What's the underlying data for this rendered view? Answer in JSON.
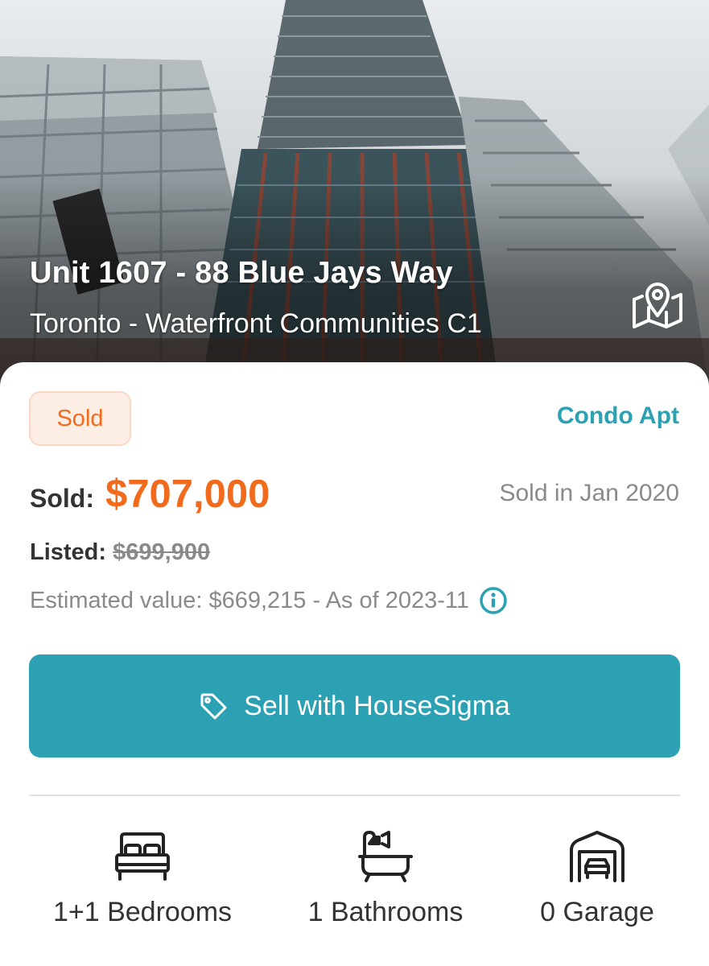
{
  "hero": {
    "title": "Unit 1607 - 88 Blue Jays Way",
    "subtitle": "Toronto - Waterfront Communities C1",
    "map_icon": "map-pin-icon"
  },
  "listing": {
    "status": "Sold",
    "property_type": "Condo Apt",
    "sold_label": "Sold:",
    "sold_price": "$707,000",
    "sold_date": "Sold in Jan 2020",
    "listed_label": "Listed:",
    "listed_price": "$699,900",
    "estimate": "Estimated value: $669,215 - As of 2023-11"
  },
  "actions": {
    "sell_label": "Sell with HouseSigma",
    "sell_icon": "tag-icon"
  },
  "features": [
    {
      "label": "1+1 Bedrooms",
      "icon": "bed-icon"
    },
    {
      "label": "1 Bathrooms",
      "icon": "bathtub-icon"
    },
    {
      "label": "0 Garage",
      "icon": "garage-icon"
    }
  ],
  "colors": {
    "accent": "#2ba1b3",
    "sold": "#f26a1b",
    "badge_bg": "#fdeee5",
    "muted": "#8a8a8a",
    "text": "#333333"
  }
}
